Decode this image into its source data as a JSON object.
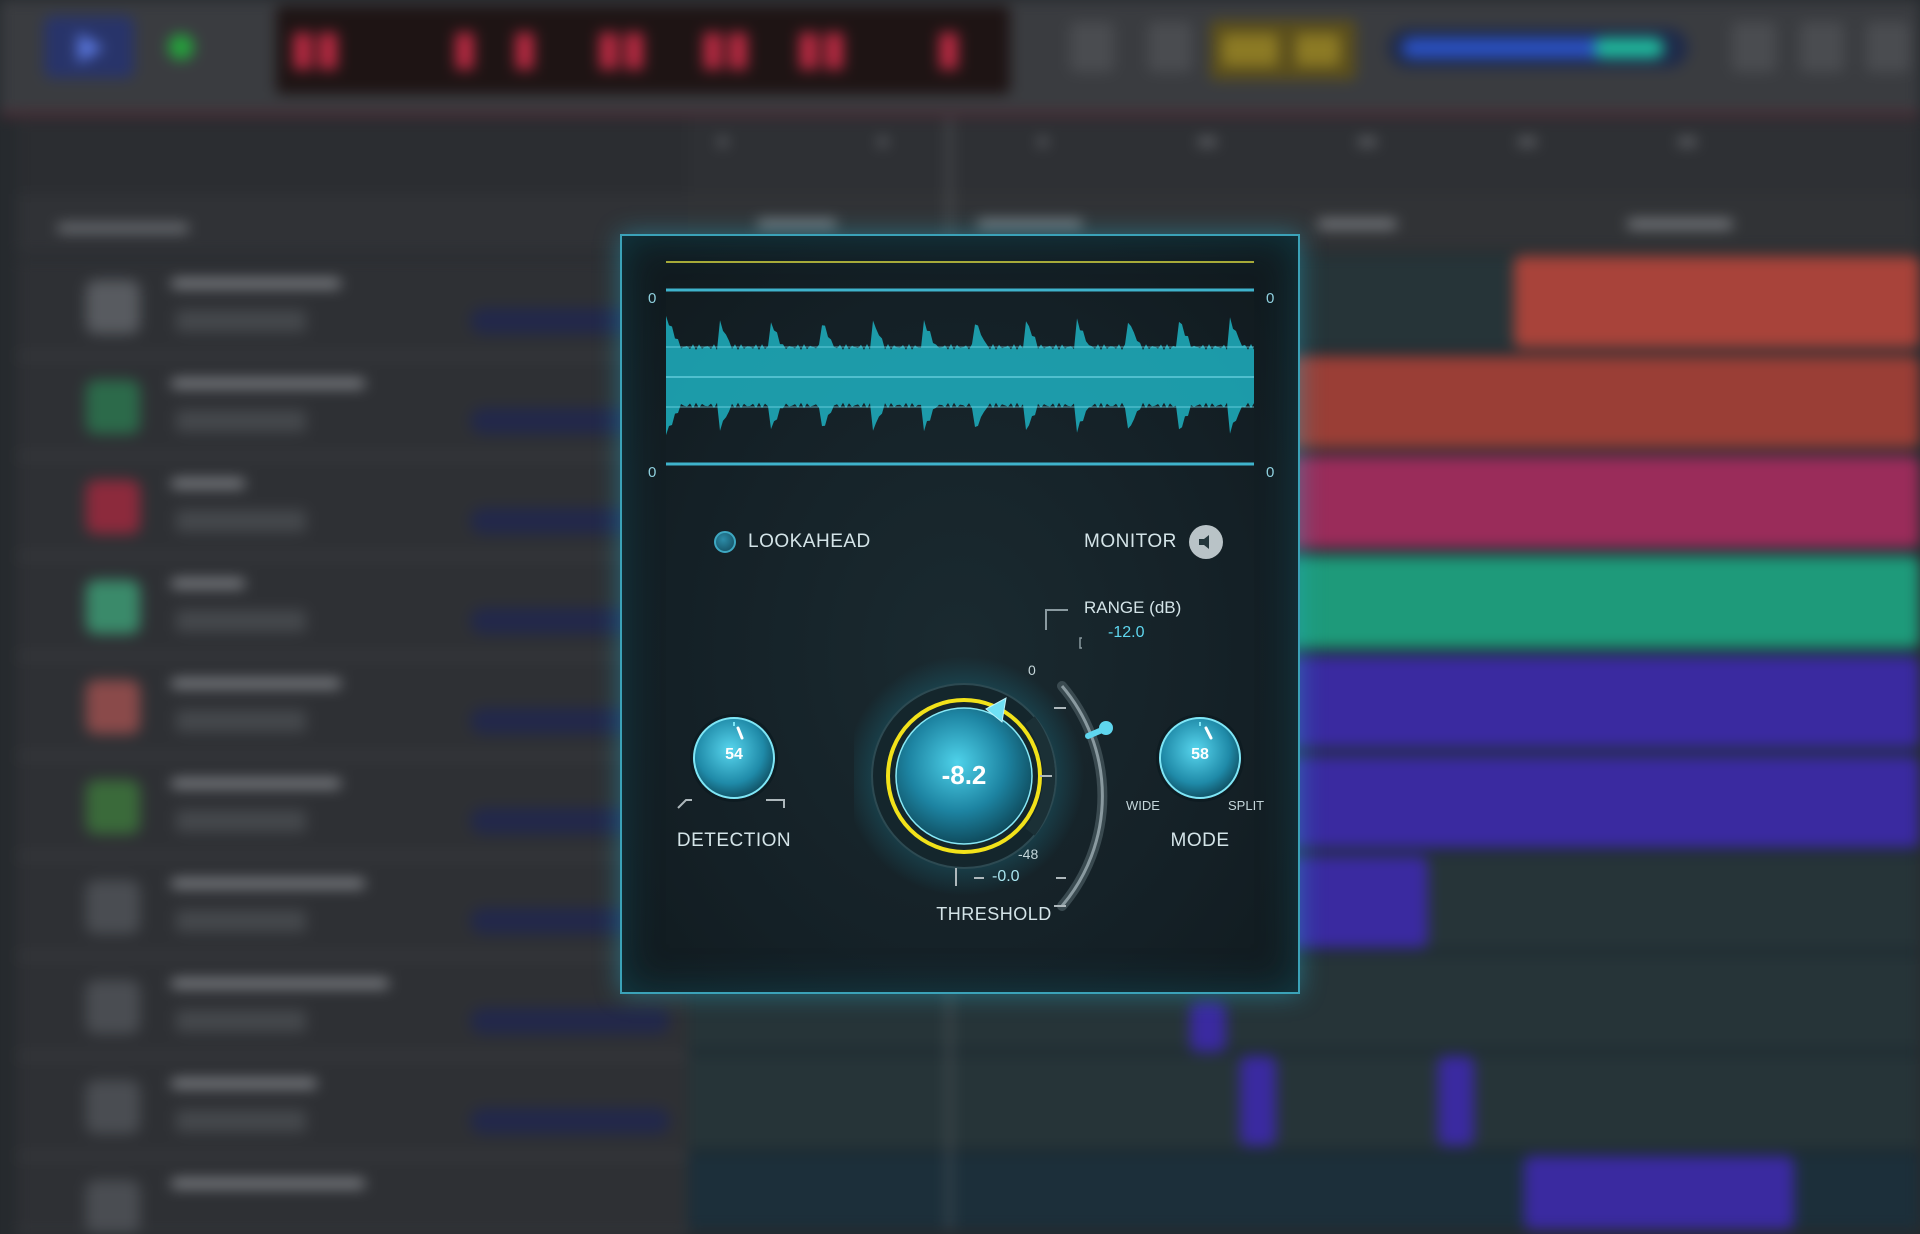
{
  "window": {
    "backdrop": "daw-arrangement-blurred"
  },
  "plugin": {
    "scope": {
      "zero_top_left": "0",
      "zero_top_right": "0",
      "zero_bottom_left": "0",
      "zero_bottom_right": "0"
    },
    "lookahead": {
      "label": "LOOKAHEAD",
      "enabled": false
    },
    "monitor": {
      "label": "MONITOR",
      "icon": "speaker-icon"
    },
    "range": {
      "title": "RANGE (dB)",
      "value": "-12.0"
    },
    "detection": {
      "label": "DETECTION",
      "value": "54"
    },
    "threshold": {
      "label": "THRESHOLD",
      "value": "-8.2",
      "scale_top": "0",
      "scale_bottom": "-48",
      "readout": "-0.0"
    },
    "mode": {
      "label": "MODE",
      "value": "58",
      "left_label": "WIDE",
      "right_label": "SPLIT"
    }
  },
  "colors": {
    "accent": "#2fd4ee",
    "panel_border": "#3ba2b8",
    "threshold_ring": "#f2e21a",
    "waveform": "#1ea8b8"
  }
}
